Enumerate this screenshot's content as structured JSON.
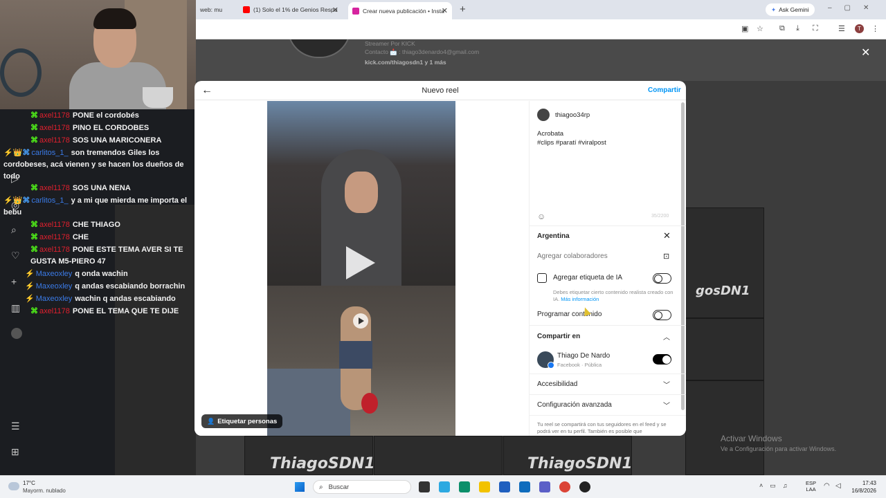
{
  "browser": {
    "tabs": [
      {
        "label": "web: mu",
        "favicon_color": "#9aa0a6"
      },
      {
        "label": "(1) Solo el 1% de Genios Respo",
        "favicon_color": "#ff0000"
      },
      {
        "label": "Crear nueva publicación • Insta",
        "favicon_color": "#d6249f"
      }
    ],
    "new_tab": "+",
    "ask_gemini": "Ask Gemini",
    "profile_initial": "T"
  },
  "background_page": {
    "profile_lines": [
      "Streamer Por KICK",
      "Contacto 📩 : thiago3denardo4@gmail.com",
      "kick.com/thiagosdn1 y 1 más"
    ],
    "overlay_close": "✕",
    "banner": "ThiagoSDN1",
    "banner_short": "gosDN1",
    "watermark_title": "Activar Windows",
    "watermark_sub": "Ve a Configuración para activar Windows."
  },
  "chat": {
    "messages": [
      {
        "user": "axel1178",
        "user_color": "red",
        "badges": "⌘",
        "text": "PONE el cordobés"
      },
      {
        "user": "axel1178",
        "user_color": "red",
        "badges": "⌘",
        "text": "PINO EL CORDOBES"
      },
      {
        "user": "axel1178",
        "user_color": "red",
        "badges": "⌘",
        "text": "SOS UNA MARICONERA"
      },
      {
        "user": "carlitos_1_",
        "user_color": "blue",
        "badges": "⚡👑⌘",
        "text": "son tremendos Giles los cordobeses, acá vienen y se hacen los dueños de todo"
      },
      {
        "user": "axel1178",
        "user_color": "red",
        "badges": "⌘",
        "text": "SOS UNA NENA"
      },
      {
        "user": "carlitos_1_",
        "user_color": "blue",
        "badges": "⚡👑⌘",
        "text": "y a mi que mierda me importa el bebu"
      },
      {
        "user": "axel1178",
        "user_color": "red",
        "badges": "⌘",
        "text": "CHE THIAGO"
      },
      {
        "user": "axel1178",
        "user_color": "red",
        "badges": "⌘",
        "text": "CHE"
      },
      {
        "user": "axel1178",
        "user_color": "red",
        "badges": "⌘",
        "text": "PONE ESTE TEMA AVER SI TE GUSTA M5-PIERO 47"
      },
      {
        "user": "Maxeoxley",
        "user_color": "blue",
        "badges": "⚡",
        "text": "q onda wachin"
      },
      {
        "user": "Maxeoxley",
        "user_color": "blue",
        "badges": "⚡",
        "text": "q andas escabiando borrachin"
      },
      {
        "user": "Maxeoxley",
        "user_color": "blue",
        "badges": "⚡",
        "text": "wachin q andas escabiando"
      },
      {
        "user": "axel1178",
        "user_color": "red",
        "badges": "⌘",
        "text": "PONE EL TEMA QUE TE DIJE"
      }
    ],
    "nav_icons": [
      "video-icon",
      "compass-icon",
      "search-icon",
      "heart-icon",
      "plus-icon",
      "chart-icon",
      "avatar",
      "menu-icon",
      "grid-icon"
    ]
  },
  "modal": {
    "title": "Nuevo reel",
    "share_label": "Compartir",
    "tag_people": "Etiquetar personas",
    "username": "thiagoo34rp",
    "caption_line1": "Acrobata",
    "caption_line2": "#clips #paratí #viralpost",
    "char_count": "35/2200",
    "location": "Argentina",
    "collaborators": "Agregar colaboradores",
    "ai_label": "Agregar etiqueta de IA",
    "ai_desc": "Debes etiquetar cierto contenido realista creado con IA.",
    "ai_more": "Más información",
    "schedule": "Programar contenido",
    "share_on": "Compartir en",
    "fb_name": "Thiago De Nardo",
    "fb_sub": "Facebook · Pública",
    "accessibility": "Accesibilidad",
    "advanced": "Configuración avanzada",
    "footer_note": "Tu reel se compartirá con tus seguidores en el feed y se podrá ver en tu perfil. También es posible que",
    "toggles": {
      "ai": false,
      "schedule": false,
      "facebook": true
    }
  },
  "taskbar": {
    "temp": "17°C",
    "weather": "Mayorm. nublado",
    "search": "Buscar",
    "lang_line1": "ESP",
    "lang_line2": "LAA",
    "time": "17:43",
    "date": "16/8/2026"
  }
}
